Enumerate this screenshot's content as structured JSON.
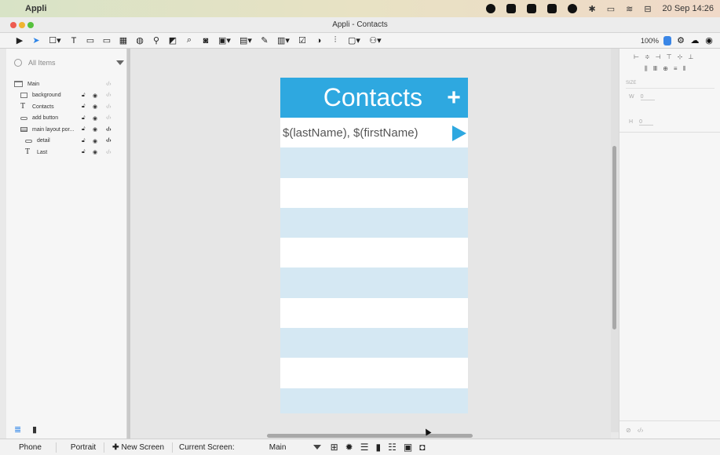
{
  "menubar": {
    "app_name": "Appli",
    "clock": "20 Sep 14:26",
    "icons": [
      "circle-icon",
      "s-badge-icon",
      "dropbox-icon",
      "grid-icon",
      "location-icon",
      "bluetooth-icon",
      "battery-icon",
      "wifi-icon",
      "control-center-icon"
    ]
  },
  "window": {
    "title": "Appli - Contacts"
  },
  "toolbar": {
    "tools": [
      {
        "icon": "play-icon",
        "glyph": "▶"
      },
      {
        "icon": "pointer-icon",
        "glyph": "➤"
      },
      {
        "icon": "rectangle-dropdown-icon",
        "glyph": "☐▾"
      },
      {
        "icon": "text-tool-icon",
        "glyph": "T"
      },
      {
        "icon": "button-tool-icon",
        "glyph": "▭"
      },
      {
        "icon": "field-tool-icon",
        "glyph": "▭"
      },
      {
        "icon": "table-tool-icon",
        "glyph": "▦"
      },
      {
        "icon": "globe-icon",
        "glyph": "◍"
      },
      {
        "icon": "map-pin-icon",
        "glyph": "⚲"
      },
      {
        "icon": "chart-icon",
        "glyph": "◩"
      },
      {
        "icon": "search-tool-icon",
        "glyph": "⌕"
      },
      {
        "icon": "camera-icon",
        "glyph": "◙"
      },
      {
        "icon": "image-dropdown-icon",
        "glyph": "▣▾"
      },
      {
        "icon": "list-dropdown-icon",
        "glyph": "▤▾"
      },
      {
        "icon": "edit-icon",
        "glyph": "✎"
      },
      {
        "icon": "form-dropdown-icon",
        "glyph": "▥▾"
      },
      {
        "icon": "checkbox-tool-icon",
        "glyph": "☑"
      },
      {
        "icon": "toggle-tool-icon",
        "glyph": "◑"
      },
      {
        "icon": "sliders-icon",
        "glyph": "⫶"
      },
      {
        "icon": "calendar-dropdown-icon",
        "glyph": "▢▾"
      },
      {
        "icon": "user-dropdown-icon",
        "glyph": "⚇▾"
      }
    ],
    "zoom": "100%"
  },
  "left_panel": {
    "search_placeholder": "All Items",
    "layers": [
      {
        "name": "Main",
        "indent": 0,
        "icon": "screen-icon",
        "code_active": false,
        "show_lock": false
      },
      {
        "name": "background",
        "indent": 1,
        "icon": "rect-layer-icon",
        "code_active": false,
        "show_lock": true
      },
      {
        "name": "Contacts",
        "indent": 1,
        "icon": "text-layer-icon",
        "code_active": false,
        "show_lock": true
      },
      {
        "name": "add button",
        "indent": 1,
        "icon": "button-layer-icon",
        "code_active": false,
        "show_lock": true
      },
      {
        "name": "main layout por...",
        "indent": 1,
        "icon": "list-layer-icon",
        "code_active": true,
        "show_lock": true
      },
      {
        "name": "detail",
        "indent": 2,
        "icon": "button-layer-icon",
        "code_active": true,
        "show_lock": true
      },
      {
        "name": "Last",
        "indent": 2,
        "icon": "text-layer-icon",
        "code_active": false,
        "show_lock": true
      }
    ]
  },
  "phone": {
    "title": "Contacts",
    "add_glyph": "+",
    "first_row_text": "$(lastName), $(firstName)",
    "header_color": "#2ea8e0",
    "alt_row_color": "#d5e8f3",
    "row_pattern": [
      "white",
      "alt",
      "white",
      "alt",
      "white",
      "alt",
      "white",
      "alt",
      "white",
      "alt"
    ]
  },
  "right_panel": {
    "size_label": "SIZE",
    "w_label": "W",
    "w_value": "0",
    "h_label": "H",
    "h_value": "0"
  },
  "statusbar": {
    "device": "Phone",
    "orientation": "Portrait",
    "new_screen": "New Screen",
    "current_screen_label": "Current Screen:",
    "current_screen_value": "Main"
  }
}
